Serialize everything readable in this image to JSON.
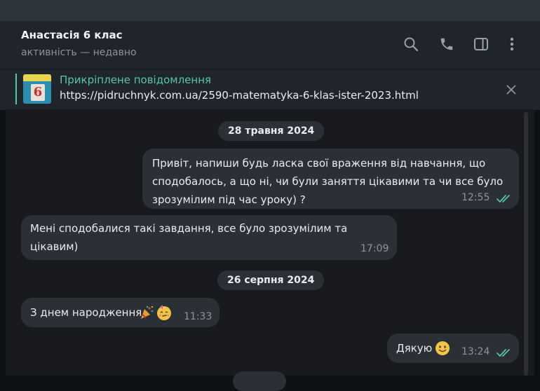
{
  "header": {
    "title": "Анастасія 6 клас",
    "status": "активність — недавно"
  },
  "pinned": {
    "label": "Прикріплене повідомлення",
    "text": "https://pidruchnyk.com.ua/2590-matematyka-6-klas-ister-2023.html",
    "thumb_number": "6"
  },
  "chat": {
    "dates": [
      "28 травня 2024",
      "26 серпня 2024"
    ],
    "messages": [
      {
        "lines": [
          "Привіт, напиши будь ласка свої враження від навчання, що",
          "сподобалось, а що ні, чи були заняття цікавими та чи все було",
          "зрозумілим під час уроку) ?"
        ],
        "time": "12:55",
        "outgoing": true,
        "read": true
      },
      {
        "lines": [
          "Мені сподобалися такі завдання, все було зрозумілим та",
          "цікавим)"
        ],
        "time": "17:09",
        "outgoing": false
      },
      {
        "text": "З днем народження",
        "emojis": [
          "party-popper",
          "partying-face"
        ],
        "time": "11:33",
        "outgoing": false
      },
      {
        "text": "Дякую",
        "emojis": [
          "slightly-smiling-face"
        ],
        "time": "13:24",
        "outgoing": true,
        "read": true
      }
    ]
  },
  "icons": [
    "search-icon",
    "phone-icon",
    "sidebar-toggle-icon",
    "more-vertical-icon",
    "close-icon",
    "read-checkmarks-icon"
  ],
  "colors": {
    "accent": "#54c7b2",
    "bubble": "#2b3036",
    "chat_background": "#17191d",
    "header_background": "#1f252b"
  }
}
